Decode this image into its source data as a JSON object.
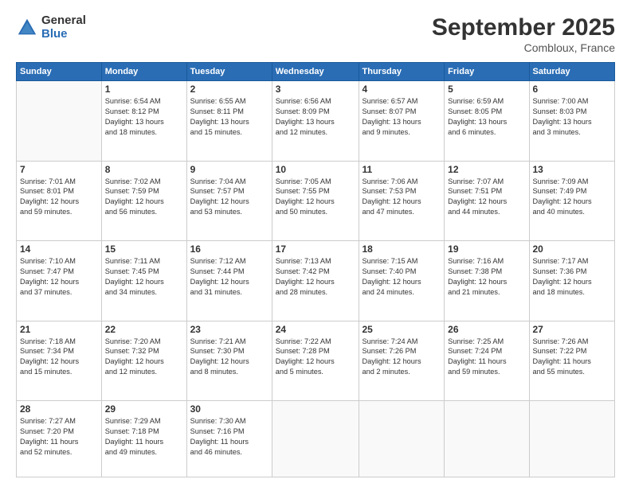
{
  "header": {
    "logo_general": "General",
    "logo_blue": "Blue",
    "month_title": "September 2025",
    "location": "Combloux, France"
  },
  "days_of_week": [
    "Sunday",
    "Monday",
    "Tuesday",
    "Wednesday",
    "Thursday",
    "Friday",
    "Saturday"
  ],
  "weeks": [
    [
      {
        "day": "",
        "info": ""
      },
      {
        "day": "1",
        "info": "Sunrise: 6:54 AM\nSunset: 8:12 PM\nDaylight: 13 hours\nand 18 minutes."
      },
      {
        "day": "2",
        "info": "Sunrise: 6:55 AM\nSunset: 8:11 PM\nDaylight: 13 hours\nand 15 minutes."
      },
      {
        "day": "3",
        "info": "Sunrise: 6:56 AM\nSunset: 8:09 PM\nDaylight: 13 hours\nand 12 minutes."
      },
      {
        "day": "4",
        "info": "Sunrise: 6:57 AM\nSunset: 8:07 PM\nDaylight: 13 hours\nand 9 minutes."
      },
      {
        "day": "5",
        "info": "Sunrise: 6:59 AM\nSunset: 8:05 PM\nDaylight: 13 hours\nand 6 minutes."
      },
      {
        "day": "6",
        "info": "Sunrise: 7:00 AM\nSunset: 8:03 PM\nDaylight: 13 hours\nand 3 minutes."
      }
    ],
    [
      {
        "day": "7",
        "info": "Sunrise: 7:01 AM\nSunset: 8:01 PM\nDaylight: 12 hours\nand 59 minutes."
      },
      {
        "day": "8",
        "info": "Sunrise: 7:02 AM\nSunset: 7:59 PM\nDaylight: 12 hours\nand 56 minutes."
      },
      {
        "day": "9",
        "info": "Sunrise: 7:04 AM\nSunset: 7:57 PM\nDaylight: 12 hours\nand 53 minutes."
      },
      {
        "day": "10",
        "info": "Sunrise: 7:05 AM\nSunset: 7:55 PM\nDaylight: 12 hours\nand 50 minutes."
      },
      {
        "day": "11",
        "info": "Sunrise: 7:06 AM\nSunset: 7:53 PM\nDaylight: 12 hours\nand 47 minutes."
      },
      {
        "day": "12",
        "info": "Sunrise: 7:07 AM\nSunset: 7:51 PM\nDaylight: 12 hours\nand 44 minutes."
      },
      {
        "day": "13",
        "info": "Sunrise: 7:09 AM\nSunset: 7:49 PM\nDaylight: 12 hours\nand 40 minutes."
      }
    ],
    [
      {
        "day": "14",
        "info": "Sunrise: 7:10 AM\nSunset: 7:47 PM\nDaylight: 12 hours\nand 37 minutes."
      },
      {
        "day": "15",
        "info": "Sunrise: 7:11 AM\nSunset: 7:45 PM\nDaylight: 12 hours\nand 34 minutes."
      },
      {
        "day": "16",
        "info": "Sunrise: 7:12 AM\nSunset: 7:44 PM\nDaylight: 12 hours\nand 31 minutes."
      },
      {
        "day": "17",
        "info": "Sunrise: 7:13 AM\nSunset: 7:42 PM\nDaylight: 12 hours\nand 28 minutes."
      },
      {
        "day": "18",
        "info": "Sunrise: 7:15 AM\nSunset: 7:40 PM\nDaylight: 12 hours\nand 24 minutes."
      },
      {
        "day": "19",
        "info": "Sunrise: 7:16 AM\nSunset: 7:38 PM\nDaylight: 12 hours\nand 21 minutes."
      },
      {
        "day": "20",
        "info": "Sunrise: 7:17 AM\nSunset: 7:36 PM\nDaylight: 12 hours\nand 18 minutes."
      }
    ],
    [
      {
        "day": "21",
        "info": "Sunrise: 7:18 AM\nSunset: 7:34 PM\nDaylight: 12 hours\nand 15 minutes."
      },
      {
        "day": "22",
        "info": "Sunrise: 7:20 AM\nSunset: 7:32 PM\nDaylight: 12 hours\nand 12 minutes."
      },
      {
        "day": "23",
        "info": "Sunrise: 7:21 AM\nSunset: 7:30 PM\nDaylight: 12 hours\nand 8 minutes."
      },
      {
        "day": "24",
        "info": "Sunrise: 7:22 AM\nSunset: 7:28 PM\nDaylight: 12 hours\nand 5 minutes."
      },
      {
        "day": "25",
        "info": "Sunrise: 7:24 AM\nSunset: 7:26 PM\nDaylight: 12 hours\nand 2 minutes."
      },
      {
        "day": "26",
        "info": "Sunrise: 7:25 AM\nSunset: 7:24 PM\nDaylight: 11 hours\nand 59 minutes."
      },
      {
        "day": "27",
        "info": "Sunrise: 7:26 AM\nSunset: 7:22 PM\nDaylight: 11 hours\nand 55 minutes."
      }
    ],
    [
      {
        "day": "28",
        "info": "Sunrise: 7:27 AM\nSunset: 7:20 PM\nDaylight: 11 hours\nand 52 minutes."
      },
      {
        "day": "29",
        "info": "Sunrise: 7:29 AM\nSunset: 7:18 PM\nDaylight: 11 hours\nand 49 minutes."
      },
      {
        "day": "30",
        "info": "Sunrise: 7:30 AM\nSunset: 7:16 PM\nDaylight: 11 hours\nand 46 minutes."
      },
      {
        "day": "",
        "info": ""
      },
      {
        "day": "",
        "info": ""
      },
      {
        "day": "",
        "info": ""
      },
      {
        "day": "",
        "info": ""
      }
    ]
  ]
}
